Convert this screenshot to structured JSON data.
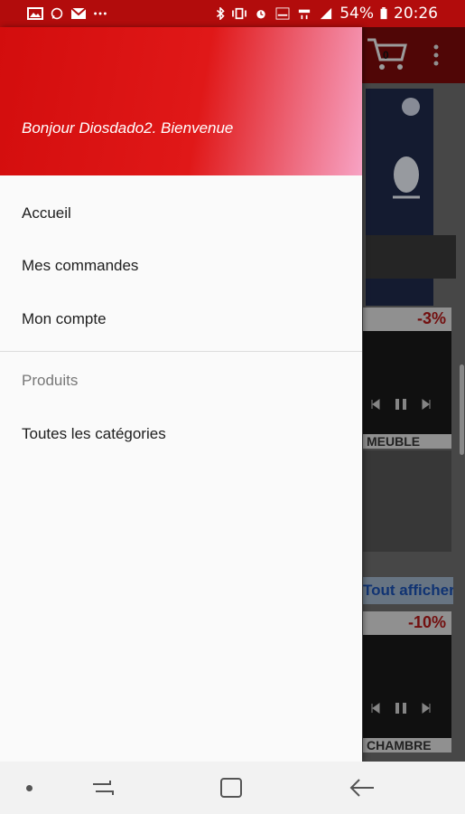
{
  "status_bar": {
    "battery": "54%",
    "time": "20:26",
    "left_icons": [
      "image-icon",
      "whatsapp-icon",
      "mail-icon",
      "more-dots-icon"
    ],
    "right_icons": [
      "bluetooth-icon",
      "vibrate-icon",
      "alarm-icon",
      "volte-icon",
      "4g-icon",
      "signal-icon",
      "battery-icon"
    ]
  },
  "drawer": {
    "greeting": "Bonjour Diosdado2. Bienvenue",
    "items": [
      {
        "label": "Accueil"
      },
      {
        "label": "Mes commandes"
      },
      {
        "label": "Mon compte"
      }
    ],
    "section_label": "Produits",
    "section_items": [
      {
        "label": "Toutes les catégories"
      }
    ]
  },
  "background": {
    "cart_count": "0",
    "cards": [
      {
        "discount": "-3%",
        "label": "MEUBLE"
      },
      {
        "discount": "-10%",
        "label": "CHAMBRE"
      }
    ],
    "link_text": "Tout afficher..."
  },
  "colors": {
    "accent": "#d30d0d",
    "header_gradient_end": "#f7a3c4"
  }
}
